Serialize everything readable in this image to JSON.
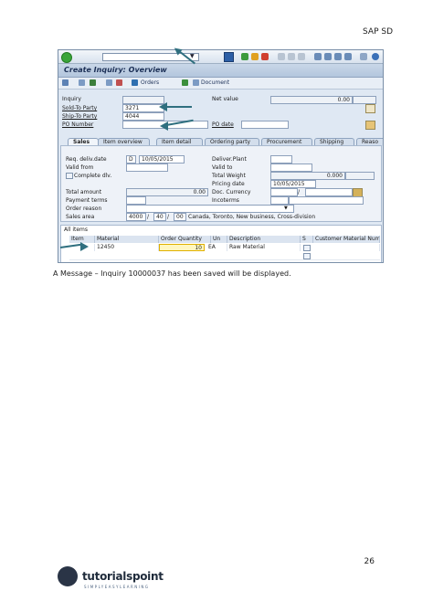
{
  "header": {
    "section": "SAP SD",
    "page_number": "26"
  },
  "caption": "A Message – Inquiry 10000037 has been saved will be displayed.",
  "sap": {
    "title": "Create Inquiry: Overview",
    "toolbar2": {
      "orders": "Orders",
      "document": "Document"
    },
    "fields": {
      "inquiry": "Inquiry",
      "net_value": "Net value",
      "net_value_value": "0.00",
      "sold_to": "Sold-To Party",
      "sold_to_value": "3271",
      "ship_to": "Ship-To Party",
      "ship_to_value": "4044",
      "po_number": "PO Number",
      "po_date": "PO date"
    },
    "tabs": [
      "Sales",
      "Item overview",
      "Item detail",
      "Ordering party",
      "Procurement",
      "Shipping",
      "Reaso"
    ],
    "sales": {
      "req_deliv_date": "Req. deliv.date",
      "req_deliv_prefix": "D",
      "req_deliv_value": "10/05/2015",
      "valid_from": "Valid from",
      "complete_dlv": "Complete dlv.",
      "deliver_plant": "Deliver.Plant",
      "valid_to": "Valid to",
      "total_weight": "Total Weight",
      "total_weight_value": "0.000",
      "pricing_date": "Pricing date",
      "pricing_date_value": "10/05/2015",
      "total_amount": "Total amount",
      "total_amount_value": "0.00",
      "doc_currency": "Doc. Currency",
      "doc_currency_sep": "/",
      "payment_terms": "Payment terms",
      "incoterms": "Incoterms",
      "order_reason": "Order reason",
      "sales_area": "Sales area",
      "sales_area_1": "4000",
      "sales_area_2": "40",
      "sales_area_3": "00",
      "sep": "/",
      "sales_area_text": "Canada, Toronto, New business, Cross-division"
    },
    "items": {
      "title": "All items",
      "columns": [
        "Item",
        "Material",
        "Order Quantity",
        "Un",
        "Description",
        "S",
        "Customer Material Num"
      ],
      "rows": [
        {
          "item": "",
          "material": "12450",
          "qty": "10",
          "unit": "EA",
          "description": "Raw Material"
        }
      ]
    }
  },
  "logo": {
    "name": "tutorialspoint",
    "tagline": "SIMPLYEASYLEARNING"
  }
}
